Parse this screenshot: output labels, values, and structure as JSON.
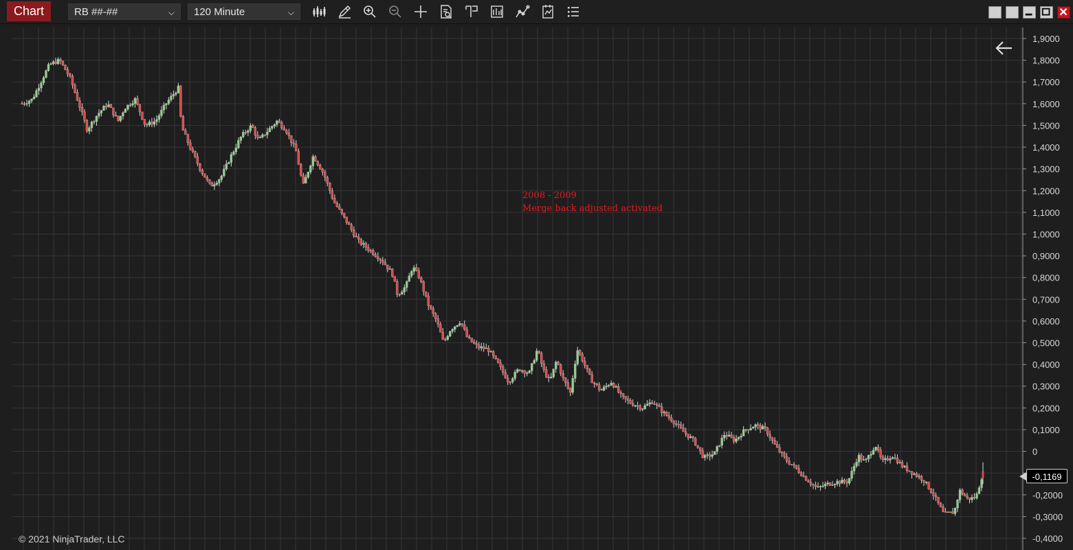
{
  "toolbar": {
    "tab_label": "Chart",
    "instrument": "RB ##-##",
    "interval": "120 Minute",
    "tools": [
      "bar-type-icon",
      "draw-pencil-icon",
      "zoom-in-icon",
      "zoom-out-icon",
      "crosshair-icon",
      "data-box-icon",
      "chart-properties-icon",
      "indicators-icon",
      "strategies-icon",
      "templates-icon",
      "object-list-icon"
    ]
  },
  "chart_data": {
    "type": "candlestick",
    "annotation_lines": [
      "2008 - 2009",
      "Merge back adjusted activated"
    ],
    "y_ticks": [
      "1,9000",
      "1,8000",
      "1,7000",
      "1,6000",
      "1,5000",
      "1,4000",
      "1,3000",
      "1,2000",
      "1,1000",
      "1,0000",
      "0,9000",
      "0,8000",
      "0,7000",
      "0,6000",
      "0,5000",
      "0,4000",
      "0,3000",
      "0,2000",
      "0,1000",
      "0",
      "-0,1000",
      "-0,2000",
      "-0,3000",
      "-0,4000"
    ],
    "ylim": [
      -0.4,
      1.9
    ],
    "last_price": "-0,1169",
    "path_keypoints": [
      [
        0,
        1.6
      ],
      [
        15,
        1.62
      ],
      [
        40,
        1.78
      ],
      [
        55,
        1.8
      ],
      [
        70,
        1.72
      ],
      [
        85,
        1.58
      ],
      [
        95,
        1.48
      ],
      [
        110,
        1.55
      ],
      [
        125,
        1.6
      ],
      [
        140,
        1.52
      ],
      [
        150,
        1.58
      ],
      [
        165,
        1.62
      ],
      [
        180,
        1.5
      ],
      [
        195,
        1.52
      ],
      [
        210,
        1.6
      ],
      [
        230,
        1.68
      ],
      [
        232,
        1.5
      ],
      [
        245,
        1.4
      ],
      [
        260,
        1.3
      ],
      [
        275,
        1.22
      ],
      [
        290,
        1.26
      ],
      [
        305,
        1.36
      ],
      [
        320,
        1.45
      ],
      [
        335,
        1.5
      ],
      [
        345,
        1.43
      ],
      [
        360,
        1.48
      ],
      [
        372,
        1.52
      ],
      [
        385,
        1.48
      ],
      [
        400,
        1.38
      ],
      [
        410,
        1.22
      ],
      [
        425,
        1.36
      ],
      [
        440,
        1.28
      ],
      [
        455,
        1.15
      ],
      [
        475,
        1.05
      ],
      [
        490,
        0.97
      ],
      [
        510,
        0.92
      ],
      [
        525,
        0.88
      ],
      [
        540,
        0.82
      ],
      [
        548,
        0.72
      ],
      [
        560,
        0.76
      ],
      [
        570,
        0.85
      ],
      [
        580,
        0.8
      ],
      [
        592,
        0.68
      ],
      [
        605,
        0.6
      ],
      [
        615,
        0.5
      ],
      [
        625,
        0.56
      ],
      [
        640,
        0.6
      ],
      [
        650,
        0.52
      ],
      [
        665,
        0.48
      ],
      [
        680,
        0.47
      ],
      [
        695,
        0.4
      ],
      [
        710,
        0.32
      ],
      [
        725,
        0.38
      ],
      [
        740,
        0.36
      ],
      [
        752,
        0.47
      ],
      [
        760,
        0.38
      ],
      [
        770,
        0.32
      ],
      [
        780,
        0.42
      ],
      [
        790,
        0.33
      ],
      [
        800,
        0.27
      ],
      [
        810,
        0.47
      ],
      [
        818,
        0.42
      ],
      [
        830,
        0.33
      ],
      [
        845,
        0.28
      ],
      [
        860,
        0.32
      ],
      [
        875,
        0.25
      ],
      [
        890,
        0.22
      ],
      [
        905,
        0.2
      ],
      [
        920,
        0.23
      ],
      [
        935,
        0.18
      ],
      [
        950,
        0.14
      ],
      [
        965,
        0.09
      ],
      [
        980,
        0.05
      ],
      [
        995,
        -0.03
      ],
      [
        1010,
        -0.01
      ],
      [
        1025,
        0.08
      ],
      [
        1040,
        0.05
      ],
      [
        1055,
        0.1
      ],
      [
        1070,
        0.12
      ],
      [
        1085,
        0.1
      ],
      [
        1100,
        0.02
      ],
      [
        1115,
        -0.04
      ],
      [
        1130,
        -0.08
      ],
      [
        1145,
        -0.13
      ],
      [
        1160,
        -0.17
      ],
      [
        1175,
        -0.15
      ],
      [
        1190,
        -0.14
      ],
      [
        1205,
        -0.14
      ],
      [
        1220,
        -0.02
      ],
      [
        1230,
        -0.05
      ],
      [
        1245,
        0.03
      ],
      [
        1255,
        -0.05
      ],
      [
        1270,
        -0.02
      ],
      [
        1285,
        -0.07
      ],
      [
        1300,
        -0.1
      ],
      [
        1315,
        -0.13
      ],
      [
        1330,
        -0.2
      ],
      [
        1345,
        -0.29
      ],
      [
        1360,
        -0.28
      ],
      [
        1368,
        -0.18
      ],
      [
        1380,
        -0.22
      ],
      [
        1392,
        -0.21
      ],
      [
        1400,
        -0.12
      ]
    ]
  },
  "footer": {
    "copyright": "© 2021 NinjaTrader, LLC"
  },
  "colors": {
    "up": "#8ed08a",
    "down": "#e04848",
    "wick": "#d8d8d8",
    "grid": "#353535",
    "bg": "#1e1e1e",
    "accent": "#8b1a1f"
  }
}
